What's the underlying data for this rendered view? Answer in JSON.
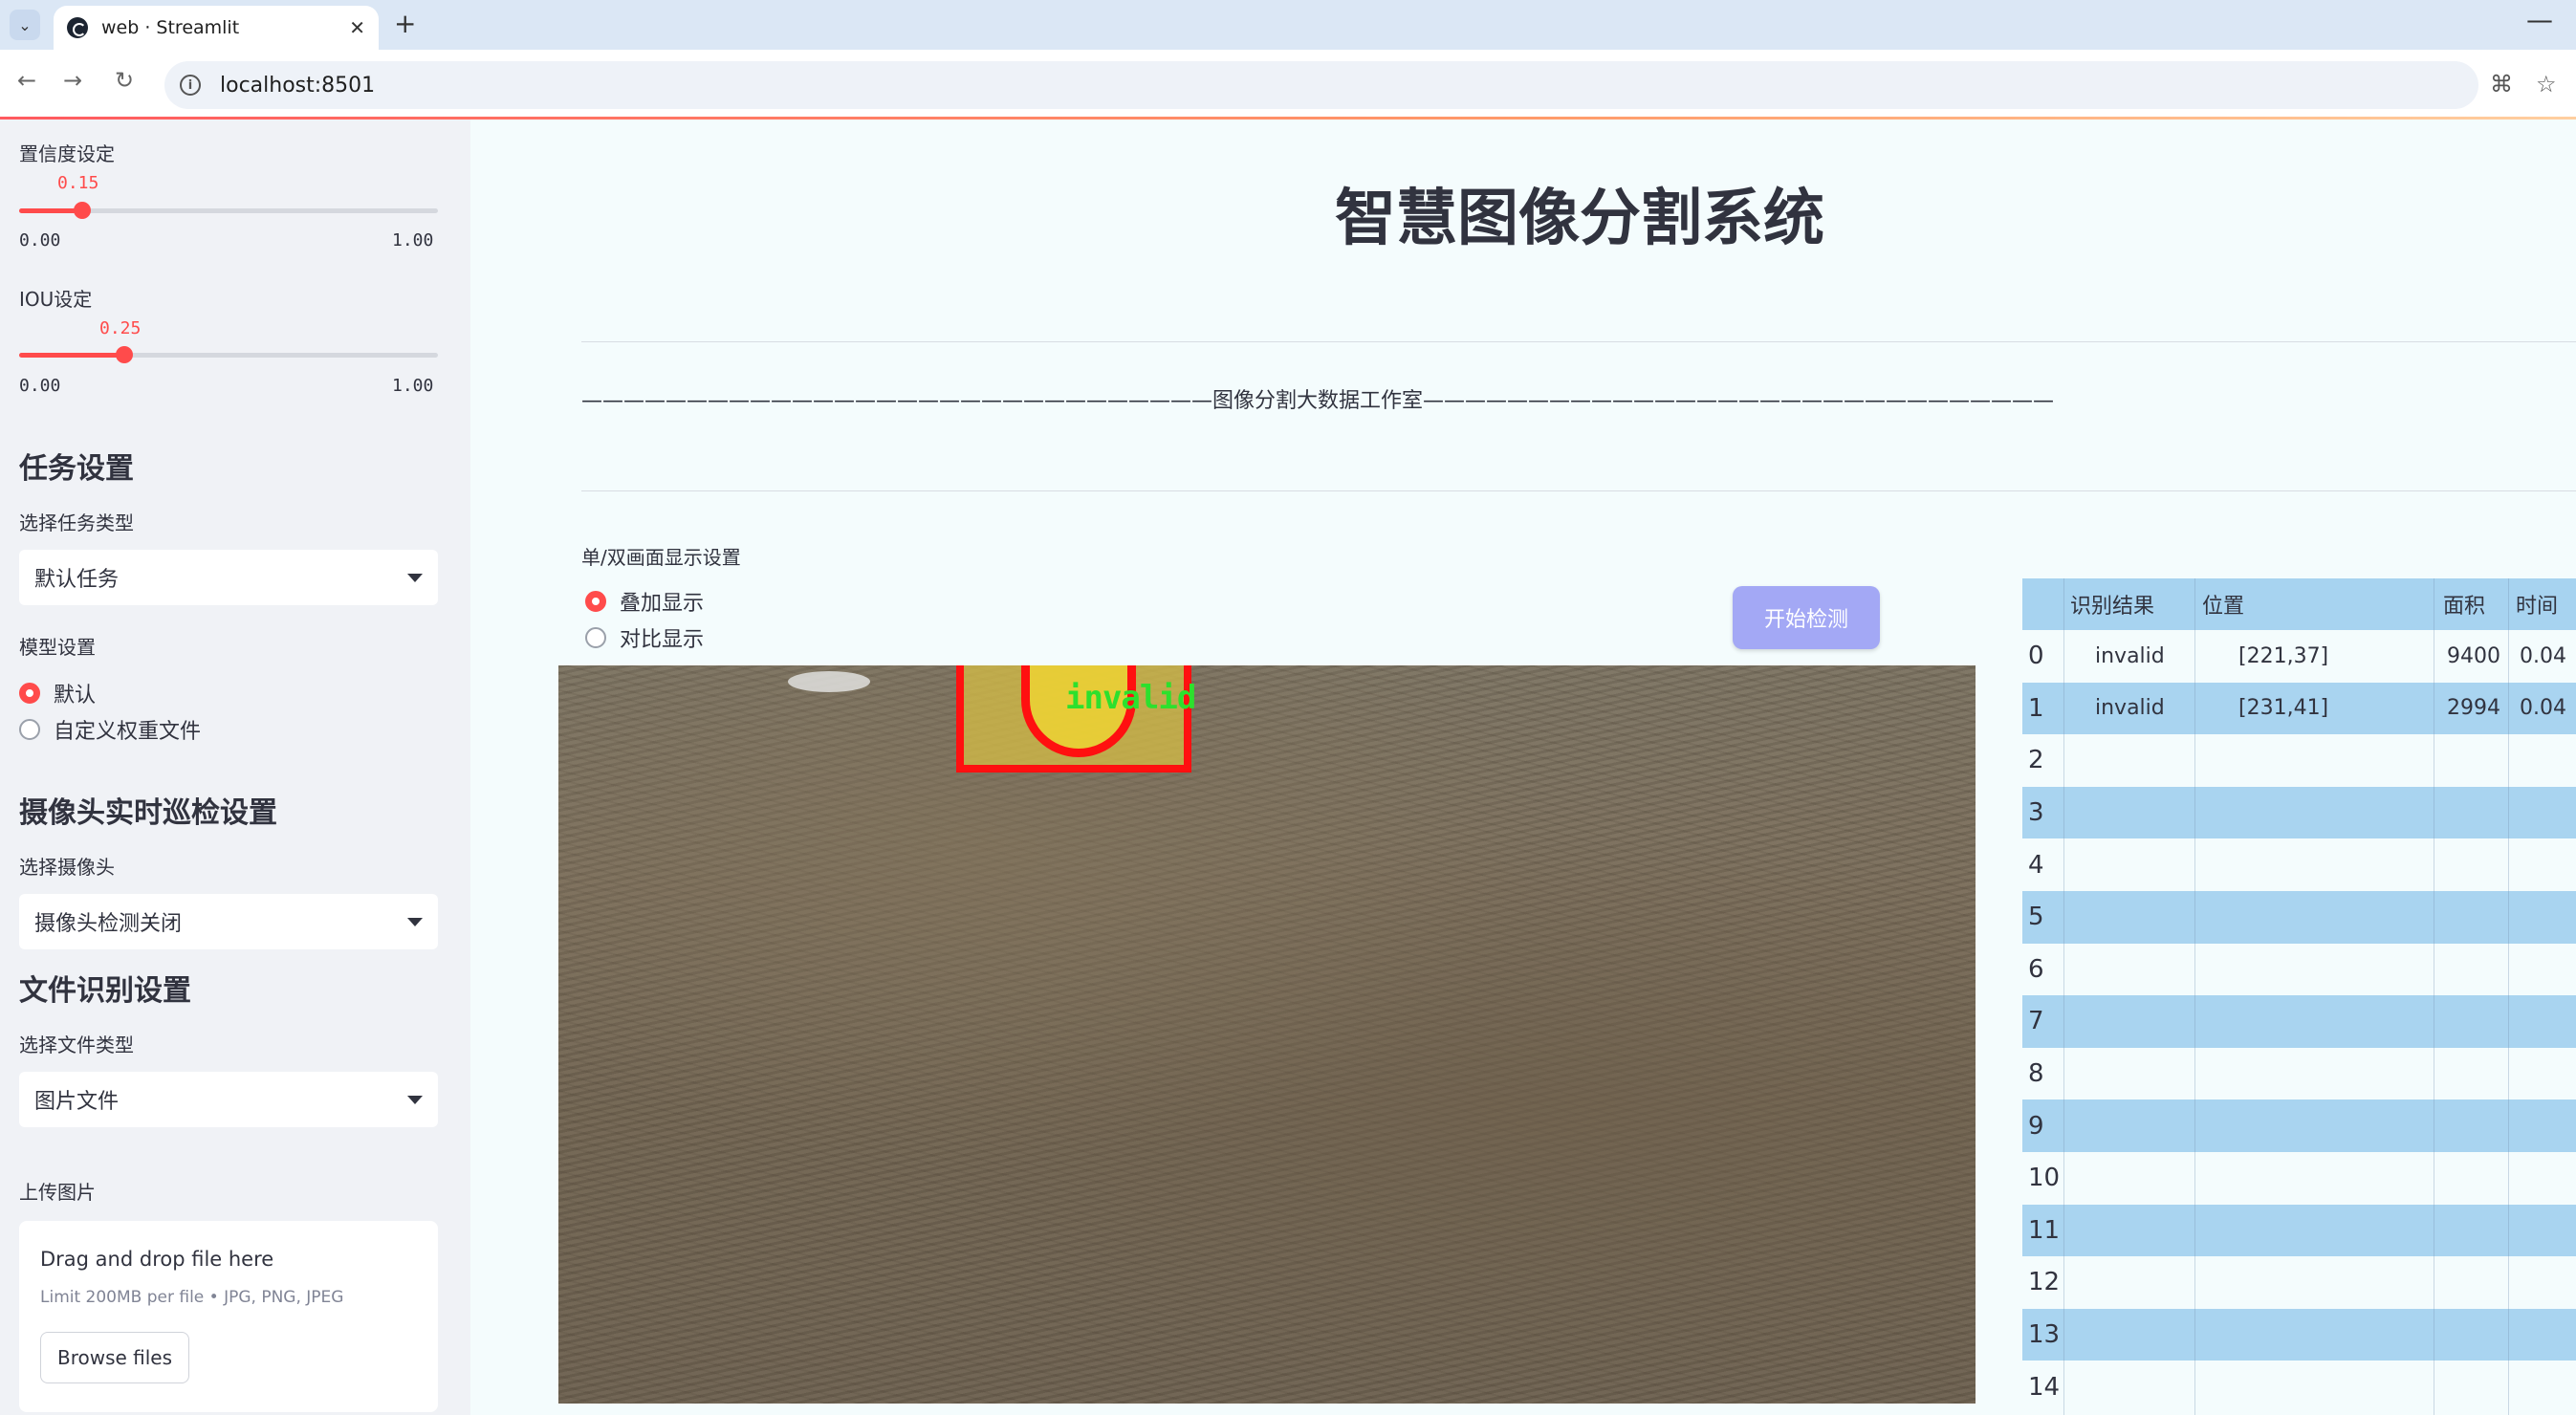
{
  "browser": {
    "tab_title": "web · Streamlit",
    "url": "localhost:8501"
  },
  "sidebar": {
    "conf_label": "置信度设定",
    "conf_value": "0.15",
    "conf_fraction": 0.15,
    "conf_min": "0.00",
    "conf_max": "1.00",
    "iou_label": "IOU设定",
    "iou_value": "0.25",
    "iou_fraction": 0.25,
    "iou_min": "0.00",
    "iou_max": "1.00",
    "task_heading": "任务设置",
    "task_type_label": "选择任务类型",
    "task_type_value": "默认任务",
    "model_label": "模型设置",
    "model_options": [
      "默认",
      "自定义权重文件"
    ],
    "camera_heading": "摄像头实时巡检设置",
    "camera_label": "选择摄像头",
    "camera_value": "摄像头检测关闭",
    "file_heading": "文件识别设置",
    "file_type_label": "选择文件类型",
    "file_type_value": "图片文件",
    "upload_label": "上传图片",
    "upload_dd": "Drag and drop file here",
    "upload_limit": "Limit 200MB per file • JPG, PNG, JPEG",
    "browse_label": "Browse files"
  },
  "main": {
    "title": "智慧图像分割系统",
    "studio_line": "——————————————————————————————图像分割大数据工作室——————————————————————————————",
    "display_label": "单/双画面显示设置",
    "display_options": [
      "叠加显示",
      "对比显示"
    ],
    "start_button": "开始检测",
    "detection_label": "invalid"
  },
  "table": {
    "headers": [
      "识别结果",
      "位置",
      "面积",
      "时间"
    ],
    "rows": [
      {
        "idx": "0",
        "result": "invalid",
        "pos": "[221,37]",
        "area": "9400",
        "time": "0.04"
      },
      {
        "idx": "1",
        "result": "invalid",
        "pos": "[231,41]",
        "area": "2994",
        "time": "0.04"
      },
      {
        "idx": "2"
      },
      {
        "idx": "3"
      },
      {
        "idx": "4"
      },
      {
        "idx": "5"
      },
      {
        "idx": "6"
      },
      {
        "idx": "7"
      },
      {
        "idx": "8"
      },
      {
        "idx": "9"
      },
      {
        "idx": "10"
      },
      {
        "idx": "11"
      },
      {
        "idx": "12"
      },
      {
        "idx": "13"
      },
      {
        "idx": "14"
      }
    ]
  },
  "colors": {
    "accent": "#ff4b4b",
    "button": "#a3a8f5",
    "table_stripe": "#a9d4f0",
    "detection_box": "#ff1010",
    "detection_text": "#2de02d"
  }
}
